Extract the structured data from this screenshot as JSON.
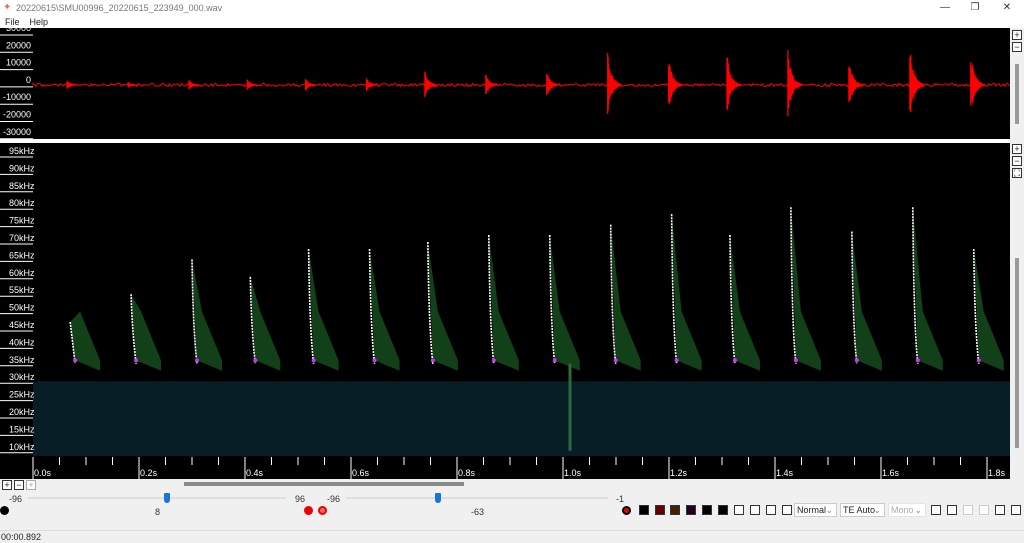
{
  "window": {
    "title": "20220615\\SMU00996_20220615_223949_000.wav",
    "minimize": "—",
    "restore": "❐",
    "close": "✕"
  },
  "menu": [
    "File",
    "Help"
  ],
  "waveform": {
    "y_labels": [
      "30000",
      "20000",
      "10000",
      "0",
      "-10000",
      "-20000",
      "-30000"
    ],
    "color": "#ff0000"
  },
  "spectrogram": {
    "freq_labels": [
      "95kHz",
      "90kHz",
      "85kHz",
      "80kHz",
      "75kHz",
      "70kHz",
      "65kHz",
      "60kHz",
      "55kHz",
      "50kHz",
      "45kHz",
      "40kHz",
      "35kHz",
      "30kHz",
      "25kHz",
      "20kHz",
      "15kHz",
      "10kHz"
    ],
    "time_labels": [
      "0.0s",
      "0.2s",
      "0.4s",
      "0.6s",
      "0.8s",
      "1.0s",
      "1.2s",
      "1.4s",
      "1.6s",
      "1.8s"
    ],
    "calls_sec": [
      0.07,
      0.185,
      0.3,
      0.41,
      0.52,
      0.635,
      0.745,
      0.86,
      0.975,
      1.09,
      1.205,
      1.315,
      1.43,
      1.545,
      1.66,
      1.775
    ],
    "call_amplitude": [
      0.1,
      0.08,
      0.12,
      0.12,
      0.14,
      0.15,
      0.35,
      0.25,
      0.3,
      0.75,
      0.65,
      0.7,
      0.8,
      0.6,
      0.9,
      0.75
    ],
    "call_top_khz": [
      47,
      55,
      65,
      60,
      68,
      68,
      70,
      72,
      72,
      75,
      78,
      72,
      80,
      73,
      80,
      68
    ]
  },
  "side_buttons": [
    "+",
    "−",
    "+",
    "−",
    "⛶"
  ],
  "zoom_buttons": [
    "+",
    "−",
    "+"
  ],
  "controls": {
    "s1_min": "-96",
    "s1_max": "96",
    "s1_value": "8",
    "s1_fraction": 0.54,
    "s2_min": "-96",
    "s2_max": "-1",
    "s2_value": "-63",
    "s2_fraction": 0.35,
    "mode": "Normal",
    "te": "TE Auto",
    "channel": "Mono"
  },
  "status": {
    "time": "00:00.892"
  }
}
